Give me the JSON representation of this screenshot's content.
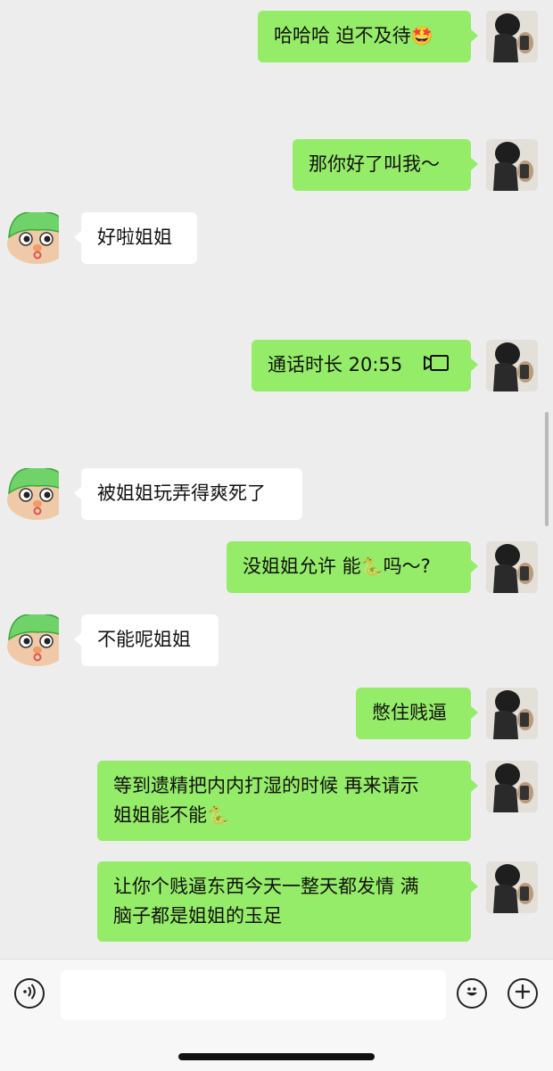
{
  "messages": [
    {
      "id": "m1",
      "side": "me",
      "text": "哈哈哈 迫不及待",
      "emoji": "🤩"
    },
    {
      "id": "m2",
      "side": "me",
      "text": "那你好了叫我～"
    },
    {
      "id": "m3",
      "side": "them",
      "text": "好啦姐姐"
    },
    {
      "id": "m4",
      "side": "me",
      "type": "video-call",
      "text": "通话时长 20:55"
    },
    {
      "id": "m5",
      "side": "them",
      "text": "被姐姐玩弄得爽死了"
    },
    {
      "id": "m6",
      "side": "me",
      "text": "没姐姐允许 能",
      "emoji": "🐍",
      "text_after": "吗～?"
    },
    {
      "id": "m7",
      "side": "them",
      "text": "不能呢姐姐"
    },
    {
      "id": "m8",
      "side": "me",
      "text": "憋住贱逼"
    },
    {
      "id": "m9",
      "side": "me",
      "line1": "等到遗精把内内打湿的时候 再来请示",
      "line2": "姐姐能不能",
      "emoji": "🐍"
    },
    {
      "id": "m10",
      "side": "me",
      "line1": "让你个贱逼东西今天一整天都发情 满",
      "line2": "脑子都是姐姐的玉足"
    }
  ],
  "input_bar": {
    "voice_icon": "voice-icon",
    "emoji_icon": "smiley-icon",
    "plus_icon": "plus-icon",
    "value": ""
  },
  "colors": {
    "my_bubble": "#95ec69",
    "their_bubble": "#ffffff",
    "background": "#ededed"
  }
}
